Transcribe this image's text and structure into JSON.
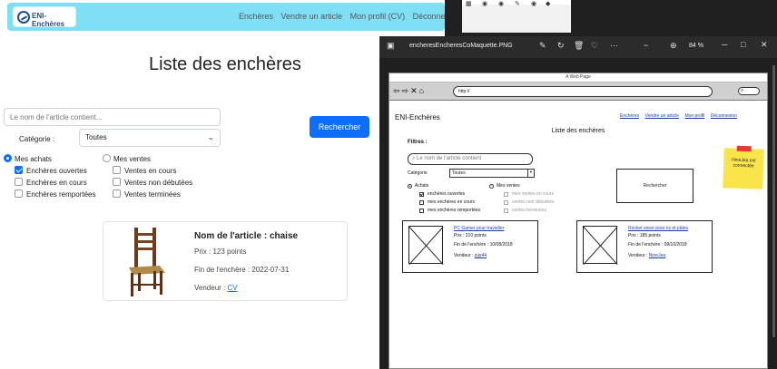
{
  "app": {
    "brand": "ENI-Enchères",
    "nav": [
      "Enchères",
      "Vendre un article",
      "Mon profil (CV)",
      "Déconnexion"
    ],
    "page_title": "Liste des enchères",
    "search_placeholder": "Le nom de l'article contient...",
    "category_label": "Catégorie :",
    "category_value": "Toutes",
    "search_button": "Rechercher",
    "radio_achats": "Mes achats",
    "radio_ventes": "Mes ventes",
    "achats_options": [
      "Enchères ouvertes",
      "Enchères en cours",
      "Enchères remportées"
    ],
    "ventes_options": [
      "Ventes en cours",
      "Ventes non débutées",
      "Ventes terminées"
    ],
    "item": {
      "title": "Nom de l'article : chaise",
      "price": "Prix : 123 points",
      "end": "Fin de l'enchère : 2022-07-31",
      "seller_label": "Vendeur :",
      "seller": "CV"
    },
    "accent": "#0d6efd",
    "navbar_color": "#7fdff5"
  },
  "viewer": {
    "file_name": "encheresEncheresCoMaquette.PNG",
    "zoom": "84 %",
    "icons": [
      "photo-icon",
      "edit-icon",
      "rotate-icon",
      "delete-icon",
      "heart-icon",
      "more-icon",
      "zoom-in-icon"
    ],
    "mockup": {
      "window_title": "A Web Page",
      "url": "http://",
      "brand": "ENI-Enchères",
      "links": [
        "Enchères",
        "Vendre un article",
        "Mon profil",
        "Déconnexion"
      ],
      "title": "Liste des enchères",
      "filters_label": "Filtres :",
      "search_placeholder": "Le nom de l'article contient",
      "category_label": "Catégorie",
      "category_value": "Toutes",
      "search_button": "Rechercher",
      "sticky_note": "NineJea est connectée",
      "radio_achats": "Achats",
      "radio_ventes": "Mes ventes",
      "achats_options": [
        "enchères ouvertes",
        "mes enchères en cours",
        "mes enchères remportées"
      ],
      "ventes_options": [
        "mes ventes en cours",
        "ventes non débutées",
        "ventes terminées"
      ],
      "cards": [
        {
          "title": "PC Gamer pour travailler",
          "price": "Prix : 210 points",
          "end": "Fin de l'enchère : 10/08/2018",
          "seller_label": "Vendeur :",
          "seller": "jojo44"
        },
        {
          "title": "Rocket stove pour riz et pâtes",
          "price": "Prix : 185 points",
          "end": "Fin de l'enchère : 09/10/2018",
          "seller_label": "Vendeur :",
          "seller": "NineJea"
        }
      ]
    }
  }
}
